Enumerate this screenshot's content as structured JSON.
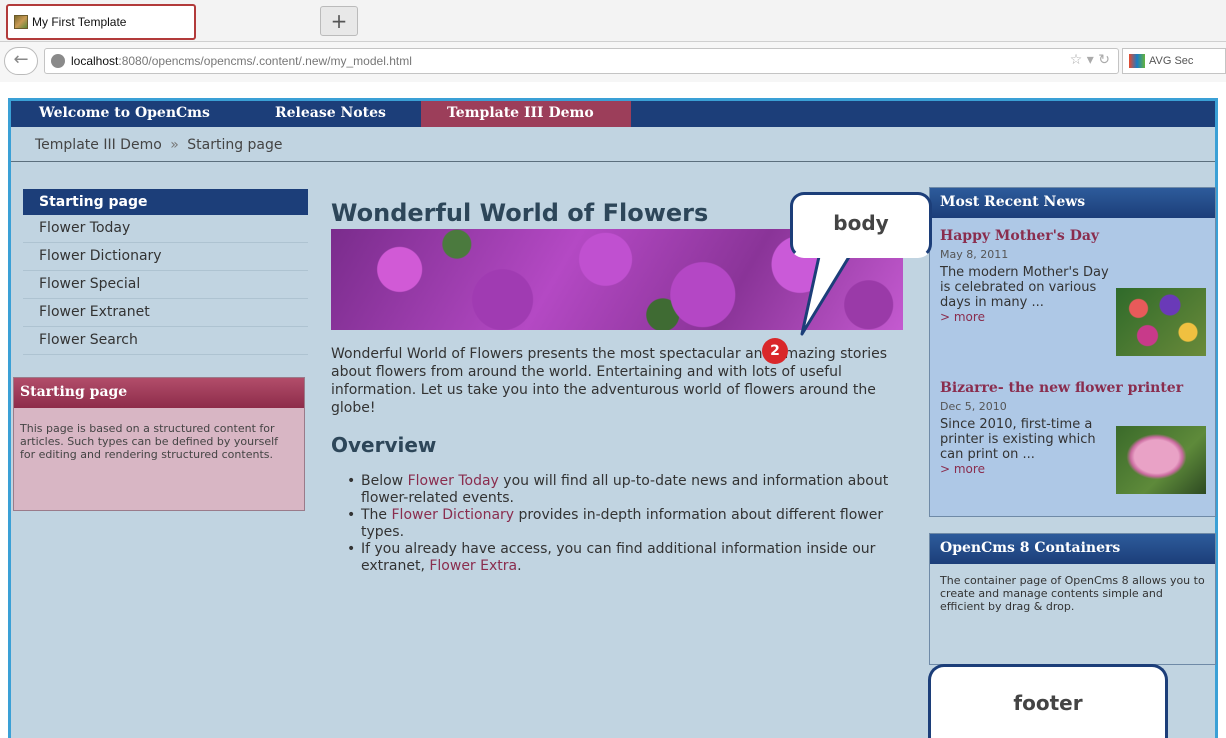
{
  "browser": {
    "tab_title": "My First Template",
    "new_tab": "+",
    "url_host": "localhost",
    "url_rest": ":8080/opencms/opencms/.content/.new/my_model.html",
    "toolbar_label": "AVG Sec"
  },
  "topnav": {
    "items": [
      "Welcome to OpenCms",
      "Release Notes",
      "Template III Demo"
    ]
  },
  "breadcrumb": {
    "items": [
      "Template III Demo",
      "Starting page"
    ],
    "separator": "»"
  },
  "sidebar": {
    "items": [
      "Starting page",
      "Flower Today",
      "Flower Dictionary",
      "Flower Special",
      "Flower Extranet",
      "Flower Search"
    ],
    "info_title": "Starting page",
    "info_text": "This page is based on a structured content for articles. Such types can be defined by yourself for editing and rendering structured contents."
  },
  "main": {
    "title": "Wonderful World of Flowers",
    "intro": "Wonderful World of Flowers presents the most spectacular and amazing stories about flowers from around the world. Entertaining and with lots of useful information. Let us take you into the adventurous world of flowers around the globe!",
    "overview_title": "Overview",
    "bullets": [
      {
        "pre": "Below ",
        "link": "Flower Today",
        "post": " you will find all up-to-date news and information about flower-related events."
      },
      {
        "pre": "The ",
        "link": "Flower Dictionary",
        "post": " provides in-depth information about different flower types."
      },
      {
        "pre": "If you already have access, you can find additional information inside our extranet, ",
        "link": "Flower Extra",
        "post": "."
      }
    ]
  },
  "news": {
    "title": "Most Recent News",
    "items": [
      {
        "title": "Happy Mother's Day",
        "date": "May 8, 2011",
        "text": "The modern Mother's Day is celebrated on various days in many ...",
        "more": "> more"
      },
      {
        "title": "Bizarre- the new flower printer",
        "date": "Dec 5, 2010",
        "text": "Since 2010, first-time a printer is existing which can print on ...",
        "more": "> more"
      }
    ]
  },
  "containers": {
    "title": "OpenCms 8 Containers",
    "text": "The container page of OpenCms 8 allows you to create and manage contents simple and efficient by drag & drop."
  },
  "callouts": {
    "body": "body",
    "footer": "footer",
    "badge": "2"
  },
  "colors": {
    "nav_blue": "#1c3e79",
    "accent_red": "#9c3e5a",
    "page_bg": "#c1d4e1",
    "link": "#8a2d4e"
  }
}
